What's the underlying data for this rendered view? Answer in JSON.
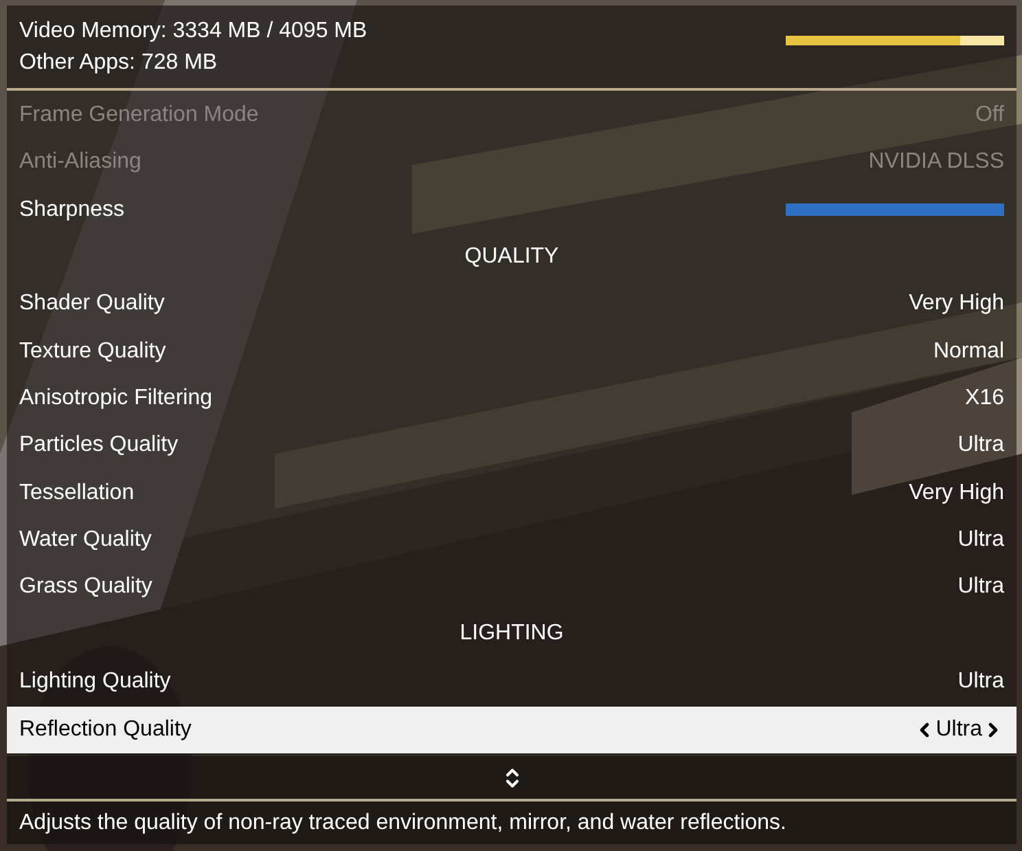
{
  "memory": {
    "video_memory": "Video Memory: 3334 MB / 4095 MB",
    "other_apps": "Other Apps: 728 MB",
    "level": 0.8
  },
  "rows": [
    {
      "kind": "option",
      "label": "Frame Generation Mode",
      "value": "Off",
      "disabled": true,
      "selected": false
    },
    {
      "kind": "option",
      "label": "Anti-Aliasing",
      "value": "NVIDIA DLSS",
      "disabled": true,
      "selected": false
    },
    {
      "kind": "slider",
      "label": "Sharpness",
      "level": 1,
      "disabled": false,
      "selected": false
    },
    {
      "kind": "section",
      "label": "QUALITY"
    },
    {
      "kind": "option",
      "label": "Shader Quality",
      "value": "Very High",
      "disabled": false,
      "selected": false
    },
    {
      "kind": "option",
      "label": "Texture Quality",
      "value": "Normal",
      "disabled": false,
      "selected": false
    },
    {
      "kind": "option",
      "label": "Anisotropic Filtering",
      "value": "X16",
      "disabled": false,
      "selected": false
    },
    {
      "kind": "option",
      "label": "Particles Quality",
      "value": "Ultra",
      "disabled": false,
      "selected": false
    },
    {
      "kind": "option",
      "label": "Tessellation",
      "value": "Very High",
      "disabled": false,
      "selected": false
    },
    {
      "kind": "option",
      "label": "Water Quality",
      "value": "Ultra",
      "disabled": false,
      "selected": false
    },
    {
      "kind": "option",
      "label": "Grass Quality",
      "value": "Ultra",
      "disabled": false,
      "selected": false
    },
    {
      "kind": "section",
      "label": "LIGHTING"
    },
    {
      "kind": "option",
      "label": "Lighting Quality",
      "value": "Ultra",
      "disabled": false,
      "selected": false
    },
    {
      "kind": "option",
      "label": "Reflection Quality",
      "value": "Ultra",
      "disabled": false,
      "selected": true
    }
  ],
  "description": "Adjusts the quality of non-ray traced environment, mirror, and water reflections."
}
